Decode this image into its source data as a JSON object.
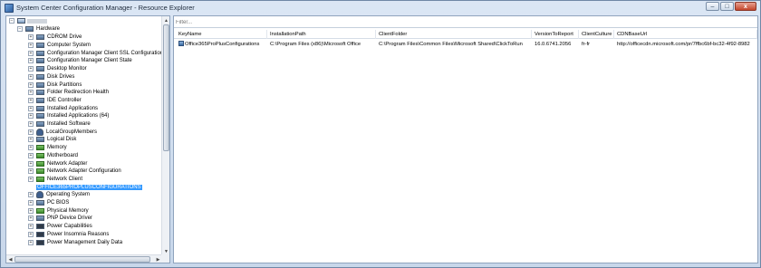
{
  "window": {
    "title": "System Center Configuration Manager - Resource Explorer",
    "controls": {
      "minimize": "–",
      "maximize": "□",
      "close": "x"
    }
  },
  "tree": {
    "root_label": "",
    "hardware_label": "Hardware",
    "items": [
      {
        "label": "CDROM Drive",
        "icon": "drive-icon"
      },
      {
        "label": "Computer System",
        "icon": "computer-icon"
      },
      {
        "label": "Configuration Manager Client SSL Configuration",
        "icon": "config-icon"
      },
      {
        "label": "Configuration Manager Client State",
        "icon": "config-icon"
      },
      {
        "label": "Desktop Monitor",
        "icon": "monitor-icon"
      },
      {
        "label": "Disk Drives",
        "icon": "disk-icon"
      },
      {
        "label": "Disk Partitions",
        "icon": "disk-icon"
      },
      {
        "label": "Folder Redirection Health",
        "icon": "folder-icon"
      },
      {
        "label": "IDE Controller",
        "icon": "controller-icon"
      },
      {
        "label": "Installed Applications",
        "icon": "app-icon"
      },
      {
        "label": "Installed Applications (64)",
        "icon": "app-icon"
      },
      {
        "label": "Installed Software",
        "icon": "app-icon"
      },
      {
        "label": "LocalGroupMembers",
        "icon": "group-icon"
      },
      {
        "label": "Logical Disk",
        "icon": "disk-icon"
      },
      {
        "label": "Memory",
        "icon": "memory-icon"
      },
      {
        "label": "Motherboard",
        "icon": "board-icon"
      },
      {
        "label": "Network Adapter",
        "icon": "network-icon"
      },
      {
        "label": "Network Adapter Configuration",
        "icon": "network-icon"
      },
      {
        "label": "Network Client",
        "icon": "network-icon"
      },
      {
        "label": "OFFICE365PROPLUSCONFIGURATIONS",
        "icon": "none",
        "selected": true
      },
      {
        "label": "Operating System",
        "icon": "os-icon"
      },
      {
        "label": "PC BIOS",
        "icon": "bios-icon"
      },
      {
        "label": "Physical Memory",
        "icon": "memory-icon"
      },
      {
        "label": "PNP Device Driver",
        "icon": "driver-icon"
      },
      {
        "label": "Power Capabilities",
        "icon": "power-icon"
      },
      {
        "label": "Power Insomnia Reasons",
        "icon": "power-icon"
      },
      {
        "label": "Power Management Daily Data",
        "icon": "power-icon"
      }
    ]
  },
  "filter": {
    "placeholder": "Filter..."
  },
  "grid": {
    "columns": [
      "KeyName",
      "InstallationPath",
      "ClientFolder",
      "VersionToReport",
      "ClientCulture",
      "CDNBaseUrl"
    ],
    "rows": [
      [
        "Office365ProPlusConfigurations",
        "C:\\Program Files (x86)\\Microsoft Office",
        "C:\\Program Files\\Common Files\\Microsoft Shared\\ClickToRun",
        "16.0.6741.2056",
        "fr-fr",
        "http://officecdn.microsoft.com/pr/7ffbc6bf-bc32-4f92-8982"
      ]
    ]
  },
  "colors": {
    "selection": "#3399ff",
    "border": "#8fa3bd"
  }
}
